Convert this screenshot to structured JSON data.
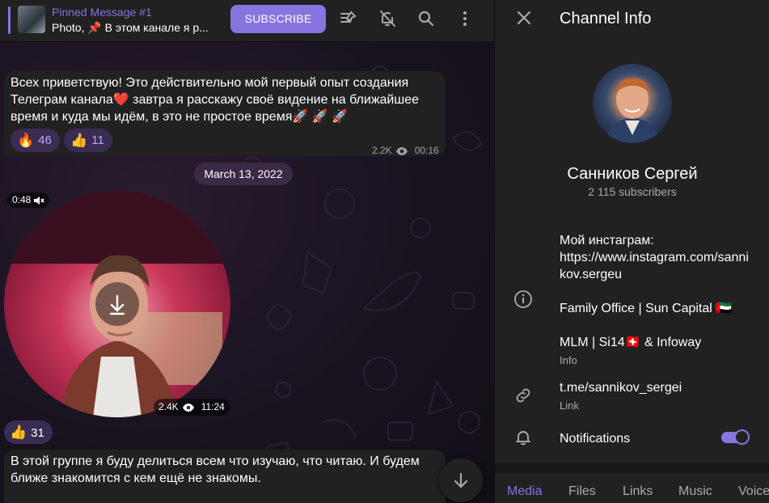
{
  "pinned": {
    "title": "Pinned Message #1",
    "text": "Photo, 📌 В этом канале я р..."
  },
  "toolbar": {
    "subscribe_label": "SUBSCRIBE",
    "icons": [
      "pin-list-icon",
      "bell-off-icon",
      "search-icon",
      "more-vert-icon"
    ]
  },
  "messages": [
    {
      "text": "Всех приветствую! Это действительно мой первый опыт создания Телеграм канала❤️  завтра я расскажу своё видение на ближайшее время и куда мы идём, в это не простое время🚀 🚀 🚀",
      "reactions": [
        {
          "emoji": "🔥",
          "count": "46"
        },
        {
          "emoji": "👍",
          "count": "11"
        }
      ],
      "views": "2.2K",
      "time": "00:16"
    },
    {
      "type": "round-video",
      "duration": "0:48",
      "views": "2.4K",
      "time": "11:24",
      "reactions": [
        {
          "emoji": "👍",
          "count": "31"
        }
      ]
    },
    {
      "text": "В этой группе я буду делиться всем что изучаю, что читаю. И будем ближе знакомится с кем ещё не знакомы."
    }
  ],
  "date_separator": "March 13, 2022",
  "info": {
    "title": "Channel Info",
    "name": "Санников Сергей",
    "subscribers": "2 115 subscribers",
    "description_lines": [
      "Мой инстаграм:",
      "https://www.instagram.com/sanni",
      "kov.sergeu",
      "Family Office | Sun Capital 🇦🇪",
      "MLM | Si14🇨🇭 & Infoway"
    ],
    "description_label": "Info",
    "link": "t.me/sannikov_sergei",
    "link_label": "Link",
    "notifications_label": "Notifications",
    "notifications_on": true,
    "tabs": [
      "Media",
      "Files",
      "Links",
      "Music",
      "Voice"
    ],
    "active_tab": "Media"
  },
  "colors": {
    "accent": "#8774e1",
    "panel": "#212121",
    "reaction_bg": "#3a2c52"
  }
}
